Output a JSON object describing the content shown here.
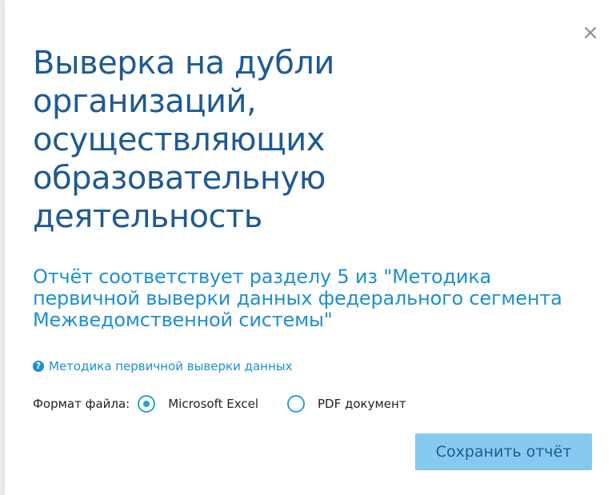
{
  "dialog": {
    "title": "Выверка на дубли организаций, осуществляющих образовательную деятельность",
    "subtitle": "Отчёт соответствует разделу 5 из \"Методика первичной выверки данных федерального сегмента Межведомственной системы\"",
    "close_glyph": "×",
    "help_link": {
      "icon": "question-circle-icon",
      "icon_glyph": "?",
      "label": "Методика первичной выверки данных"
    },
    "format": {
      "label": "Формат файла:",
      "options": [
        {
          "label": "Microsoft Excel",
          "selected": true
        },
        {
          "label": "PDF документ",
          "selected": false
        }
      ]
    },
    "save_label": "Сохранить отчёт"
  },
  "colors": {
    "title": "#1f5a93",
    "accent": "#1e8fd0",
    "radio": "#2aa0d8",
    "button_bg": "#86caef",
    "button_text": "#1c5f8f"
  }
}
